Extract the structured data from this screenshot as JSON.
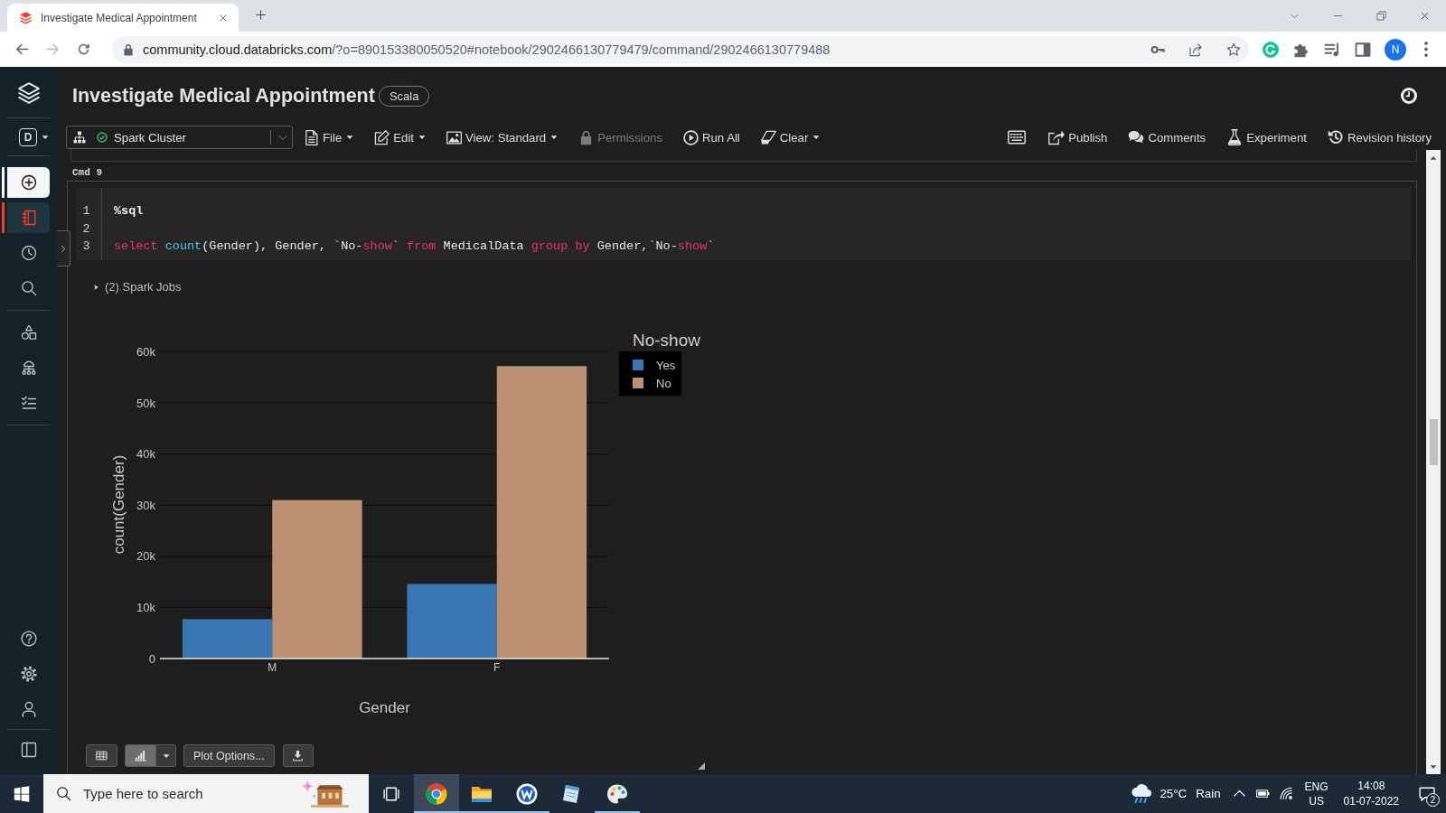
{
  "browser": {
    "tab": {
      "title": "Investigate Medical Appointment"
    },
    "nav": {
      "forward_disabled": true
    },
    "url": {
      "host": "community.cloud.databricks.com",
      "path": "/?o=890153380050520#notebook/2902466130779479/command/2902466130779488"
    },
    "profile": "N"
  },
  "sidebar": {
    "workspace": "D",
    "top_groups": [
      {
        "items": [
          {
            "kind": "create",
            "selected": false
          },
          {
            "kind": "notebook",
            "selected": true
          },
          {
            "kind": "clock",
            "selected": false
          },
          {
            "kind": "search",
            "selected": false
          }
        ]
      },
      {
        "items": [
          {
            "kind": "shapes",
            "selected": false
          },
          {
            "kind": "hierarchy",
            "selected": false
          },
          {
            "kind": "checklist",
            "selected": false
          }
        ]
      }
    ],
    "bottom_groups": [
      {
        "items": [
          {
            "kind": "help",
            "selected": false
          },
          {
            "kind": "settings",
            "selected": false
          },
          {
            "kind": "user",
            "selected": false
          }
        ]
      },
      {
        "items": [
          {
            "kind": "panel",
            "selected": false
          }
        ]
      }
    ]
  },
  "notebook": {
    "title": "Investigate Medical Appointment",
    "language": "Scala"
  },
  "toolbar": {
    "cluster": {
      "name": "Spark Cluster",
      "running": true
    },
    "menus": [
      {
        "kind": "file",
        "label": "File",
        "dropdown": true,
        "disabled": false
      },
      {
        "kind": "edit",
        "label": "Edit",
        "dropdown": true,
        "disabled": false
      },
      {
        "kind": "view",
        "label": "View: Standard",
        "dropdown": true,
        "disabled": false
      },
      {
        "kind": "permissions",
        "label": "Permissions",
        "dropdown": false,
        "disabled": true
      },
      {
        "kind": "run",
        "label": "Run All",
        "dropdown": false,
        "disabled": false
      },
      {
        "kind": "clear",
        "label": "Clear",
        "dropdown": true,
        "disabled": false
      }
    ],
    "actions": [
      {
        "kind": "keyboard"
      },
      {
        "kind": "publish",
        "label": "Publish"
      },
      {
        "kind": "comments",
        "label": "Comments"
      },
      {
        "kind": "experiment",
        "label": "Experiment"
      },
      {
        "kind": "history",
        "label": "Revision history"
      }
    ]
  },
  "cell": {
    "label": "Cmd 9",
    "lines": [
      {
        "number": "1",
        "tokens": [
          {
            "kind": "magic",
            "text": "%sql"
          }
        ]
      },
      {
        "number": "2"
      },
      {
        "number": "3",
        "tokens": [
          {
            "kind": "keyword",
            "text": "select"
          },
          {
            "kind": "function",
            "text": " count"
          },
          {
            "kind": "plain",
            "text": "(Gender), Gender, `No-"
          },
          {
            "kind": "keyword",
            "text": "show"
          },
          {
            "kind": "plain",
            "text": "` "
          },
          {
            "kind": "keyword",
            "text": "from"
          },
          {
            "kind": "plain",
            "text": " MedicalData "
          },
          {
            "kind": "keyword",
            "text": "group by"
          },
          {
            "kind": "plain",
            "text": " Gender,`No-"
          },
          {
            "kind": "keyword",
            "text": "show"
          },
          {
            "kind": "plain",
            "text": "`"
          }
        ]
      }
    ],
    "spark_jobs": {
      "label": "(2) Spark Jobs",
      "expanded": false
    },
    "chart": {
      "chart_data": {
        "type": "bar",
        "xlabel": "Gender",
        "ylabel": "count(Gender)",
        "categories": [
          "M",
          "F"
        ],
        "series": [
          {
            "name": "Yes",
            "color": "#3776b0",
            "values": [
              7700,
              14600
            ]
          },
          {
            "name": "No",
            "color": "#bc9173",
            "values": [
              31000,
              57200
            ]
          }
        ],
        "ylim": [
          0,
          60260
        ],
        "yticks": [
          {
            "value": 0,
            "label": "0"
          },
          {
            "value": 10000,
            "label": "10k"
          },
          {
            "value": 20000,
            "label": "20k"
          },
          {
            "value": 30000,
            "label": "30k"
          },
          {
            "value": 40000,
            "label": "40k"
          },
          {
            "value": 50000,
            "label": "50k"
          },
          {
            "value": 60000,
            "label": "60k"
          }
        ],
        "grid": true,
        "legend": {
          "title": "No-show"
        }
      }
    },
    "plot_controls": {
      "views": [
        {
          "kind": "table",
          "selected": false
        },
        {
          "kind": "chart",
          "selected": true
        }
      ],
      "options_label": "Plot Options..."
    }
  },
  "taskbar": {
    "search": {
      "placeholder": "Type here to search"
    },
    "apps": [
      {
        "kind": "browser",
        "running": true,
        "selected": true
      },
      {
        "kind": "folder",
        "running": true,
        "selected": false
      },
      {
        "kind": "letter_circle",
        "running": true,
        "selected": false
      },
      {
        "kind": "notepad",
        "running": false,
        "selected": false
      },
      {
        "kind": "palette",
        "running": true,
        "selected": false
      }
    ],
    "weather": {
      "temperature": "25°C",
      "condition": "Rain"
    },
    "language": {
      "input": "ENG",
      "region": "US"
    },
    "clock": {
      "time": "14:08",
      "date": "01-07-2022"
    },
    "notifications": "2"
  }
}
